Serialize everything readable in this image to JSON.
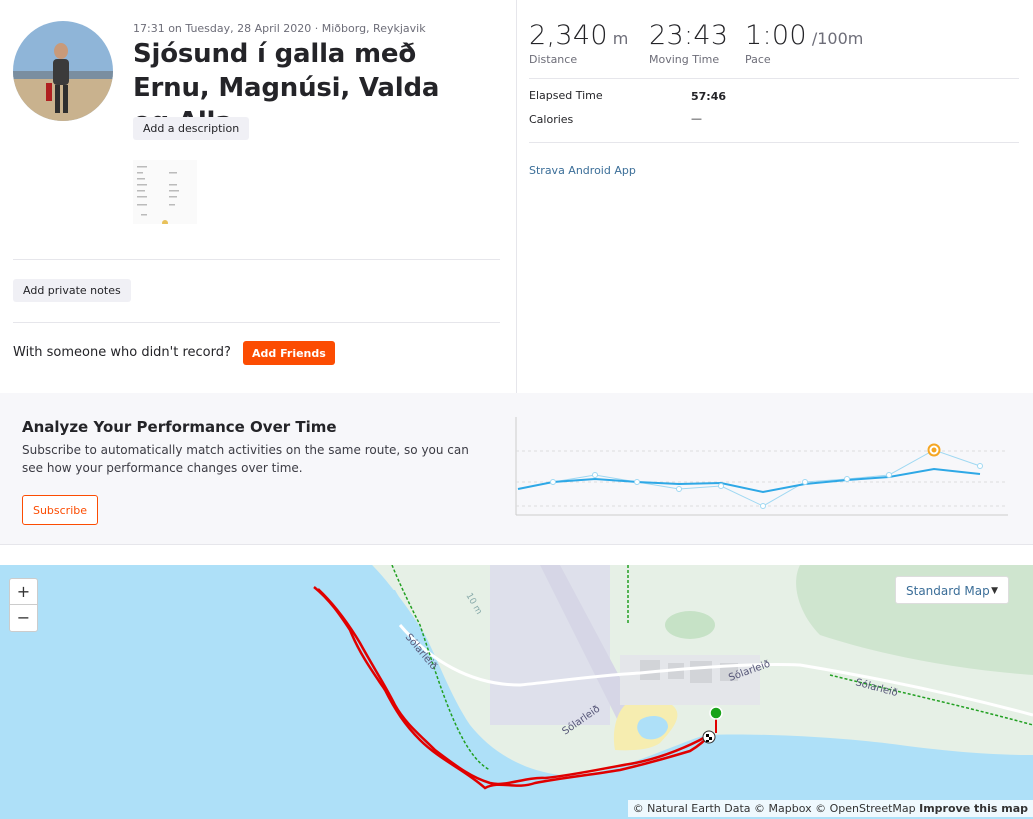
{
  "activity": {
    "meta": "17:31 on Tuesday, 28 April 2020 · Miðborg, Reykjavik",
    "title": "Sjósund í galla með Ernu, Magnúsi, Valda og Alla",
    "add_description": "Add a description",
    "add_private_notes": "Add private notes",
    "with_someone": "With someone who didn't record?",
    "add_friends": "Add Friends"
  },
  "stats": {
    "distance": {
      "value": "2,340",
      "unit": "m",
      "label": "Distance"
    },
    "moving_time": {
      "value": "23:43",
      "label": "Moving Time"
    },
    "pace": {
      "value": "1:00",
      "unit": "/100m",
      "label": "Pace"
    },
    "elapsed_label": "Elapsed Time",
    "elapsed_value": "57:46",
    "calories_label": "Calories",
    "calories_value": "—",
    "device": "Strava Android App"
  },
  "analyze": {
    "heading": "Analyze Your Performance Over Time",
    "text": "Subscribe to automatically match activities on the same route, so you can see how your performance changes over time.",
    "subscribe": "Subscribe"
  },
  "map": {
    "zoom_in": "+",
    "zoom_out": "−",
    "map_type": "Standard Map",
    "road_label": "Sólarleið",
    "depth_label": "10 m",
    "attribution": "© Natural Earth Data © Mapbox © OpenStreetMap",
    "improve": "Improve this map",
    "colors": {
      "water": "#aee0f8",
      "land": "#e6f0e6",
      "route": "#e00000",
      "start": "#1aa31a"
    }
  },
  "colors": {
    "accent": "#fc4c02",
    "link": "#3b6e98"
  }
}
